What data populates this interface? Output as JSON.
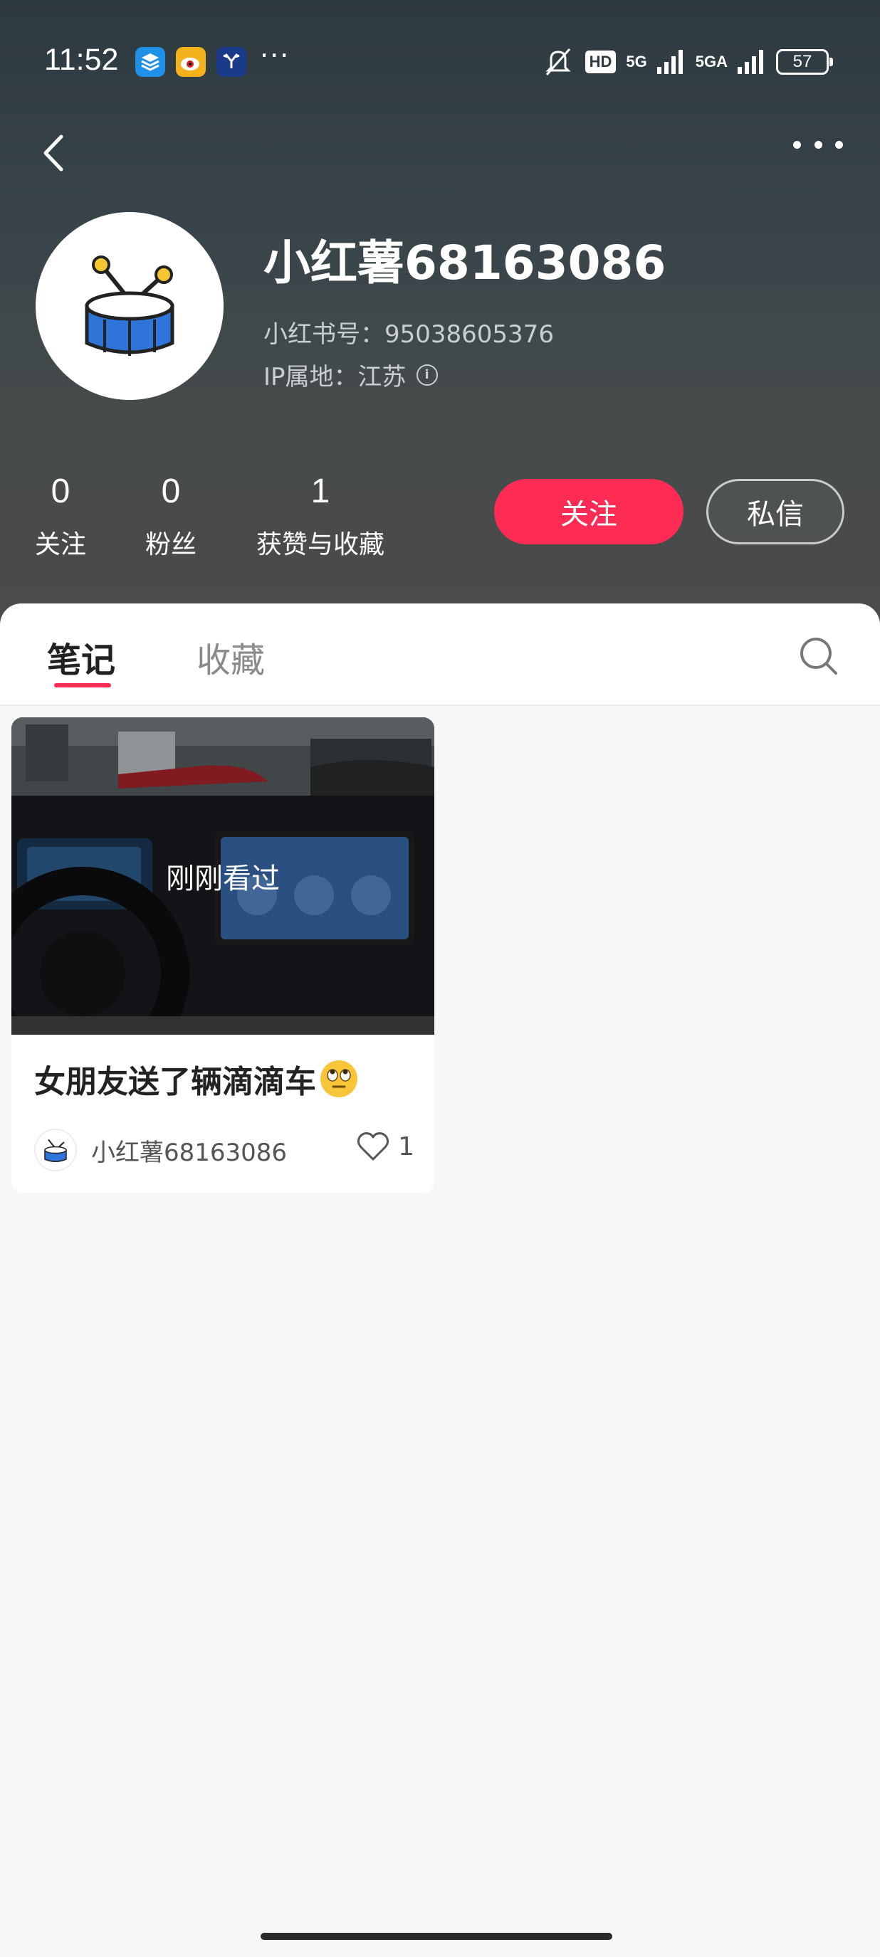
{
  "status_bar": {
    "time": "11:52",
    "more": "···",
    "hd": "HD",
    "net1": "5G",
    "net2": "5GA",
    "battery": "57"
  },
  "profile": {
    "username": "小红薯68163086",
    "red_id": "小红书号：95038605376",
    "ip": "IP属地：江苏",
    "stats": [
      {
        "value": "0",
        "label": "关注"
      },
      {
        "value": "0",
        "label": "粉丝"
      },
      {
        "value": "1",
        "label": "获赞与收藏"
      }
    ],
    "follow_label": "关注",
    "message_label": "私信"
  },
  "tabs": [
    {
      "label": "笔记",
      "active": true
    },
    {
      "label": "收藏",
      "active": false
    }
  ],
  "notes": [
    {
      "overlay": "刚刚看过",
      "title": "女朋友送了辆滴滴车",
      "author": "小红薯68163086",
      "likes": "1"
    }
  ],
  "colors": {
    "accent": "#fe2c55",
    "header_bg": "#3a4448"
  }
}
